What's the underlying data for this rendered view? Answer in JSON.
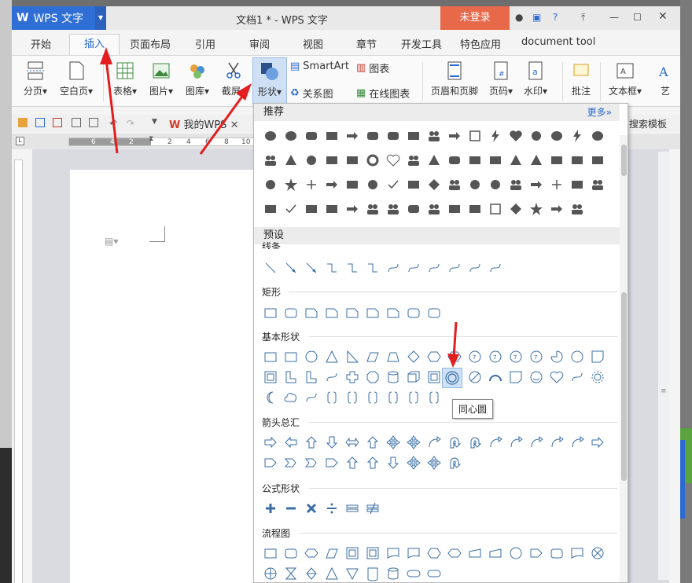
{
  "titlebar": {
    "app_logo": "W",
    "app_name": "WPS 文字",
    "doc_title": "文档1 * - WPS 文字",
    "login": "未登录"
  },
  "menu": [
    "开始",
    "插入",
    "页面布局",
    "引用",
    "审阅",
    "视图",
    "章节",
    "开发工具",
    "特色应用",
    "document tool"
  ],
  "active_tab": "插入",
  "ribbon": {
    "page_break": "分页",
    "blank_page": "空白页",
    "table": "表格",
    "picture": "图片",
    "gallery": "图库",
    "screenshot": "截屏",
    "shapes": "形状",
    "smartart": "SmartArt",
    "chart": "图表",
    "relation": "关系图",
    "online_chart": "在线图表",
    "header_footer": "页眉和页脚",
    "page_number": "页码",
    "watermark": "水印",
    "comment": "批注",
    "textbox": "文本框",
    "art": "艺"
  },
  "quickbar": {
    "tab_label": "我的WPS",
    "search_template": "搜索模板"
  },
  "ruler_numbers": [
    "6",
    "4",
    "2",
    "2",
    "4",
    "6",
    "8",
    "10"
  ],
  "panel": {
    "header_recommended": "推荐",
    "more": "更多»",
    "header_preset": "预设",
    "sections": {
      "lines": "线条",
      "rect": "矩形",
      "basic": "基本形状",
      "arrows": "箭头总汇",
      "formula": "公式形状",
      "flowchart": "流程图"
    },
    "tooltip": "同心圆",
    "highlight_color": "#cfe2f8"
  },
  "colors": {
    "wps_blue": "#2f6fd5",
    "login_red": "#e8684a",
    "annotation_red": "#e21e1e"
  }
}
